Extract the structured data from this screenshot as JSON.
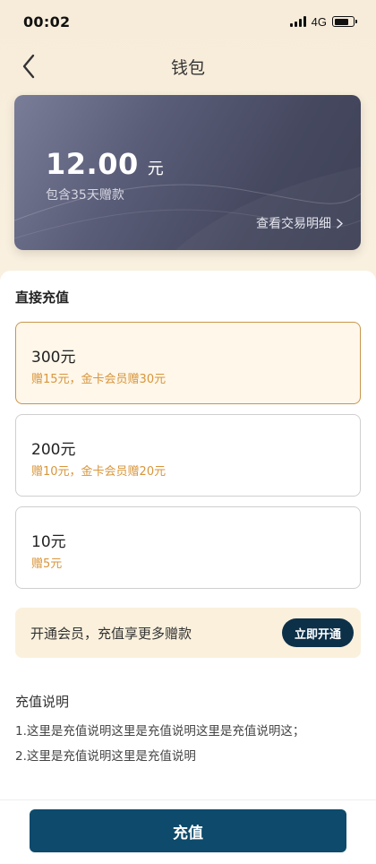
{
  "status_bar": {
    "time": "00:02",
    "network": "4G"
  },
  "nav": {
    "title": "钱包"
  },
  "wallet": {
    "balance": "12.00",
    "unit": "元",
    "subtitle": "包含35天赠款",
    "detail_link": "查看交易明细"
  },
  "recharge": {
    "section_title": "直接充值",
    "options": [
      {
        "amount": "300元",
        "bonus": "赠15元，金卡会员赠30元",
        "selected": true
      },
      {
        "amount": "200元",
        "bonus": "赠10元，金卡会员赠20元",
        "selected": false
      },
      {
        "amount": "10元",
        "bonus": "赠5元",
        "selected": false
      }
    ]
  },
  "member": {
    "text": "开通会员，充值享更多赠款",
    "button": "立即开通"
  },
  "notes": {
    "title": "充值说明",
    "lines": [
      "1.这里是充值说明这里是充值说明这里是充值说明这；",
      "2.这里是充值说明这里是充值说明"
    ]
  },
  "action": {
    "button": "充值"
  },
  "colors": {
    "accent_dark": "#0d4a6b",
    "member_button": "#0d3049",
    "bonus_text": "#d8953a",
    "selected_border": "#c8964c"
  },
  "icons": {
    "back": "chevron-left-icon",
    "detail": "chevron-right-icon"
  }
}
